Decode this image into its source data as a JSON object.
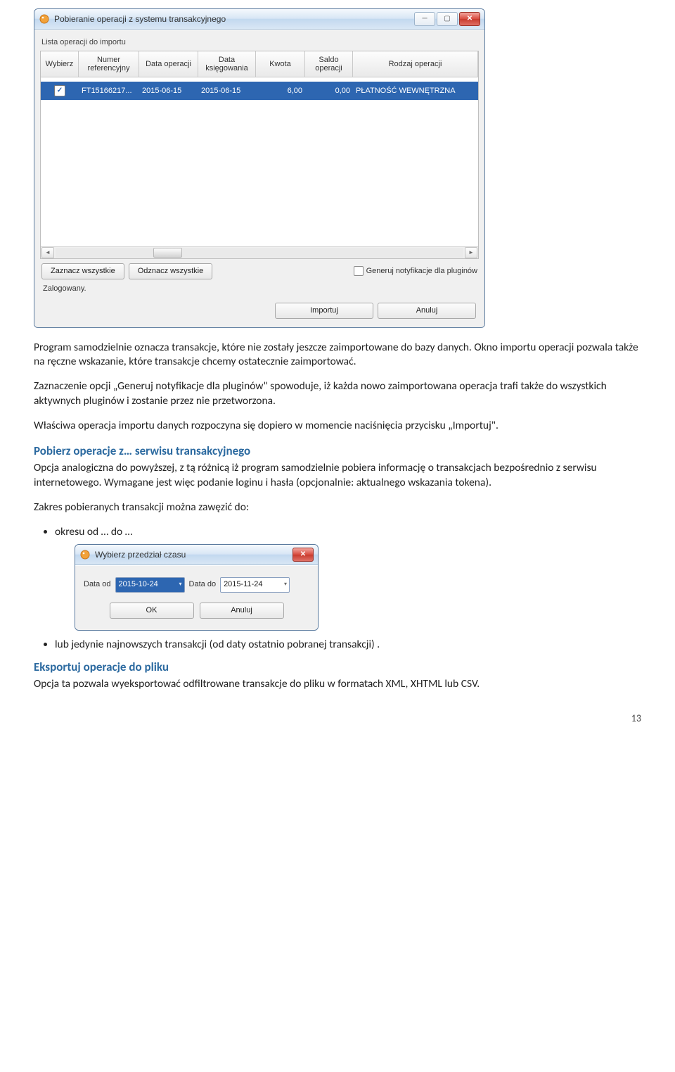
{
  "page_number": "13",
  "main_window": {
    "title": "Pobieranie operacji z systemu transakcyjnego",
    "list_label": "Lista operacji do importu",
    "columns": {
      "c1": "Wybierz",
      "c2": "Numer referencyjny",
      "c3": "Data operacji",
      "c4": "Data księgowania",
      "c5": "Kwota",
      "c6": "Saldo operacji",
      "c7": "Rodzaj operacji"
    },
    "row": {
      "checked_glyph": "✓",
      "ref": "FT15166217...",
      "op_date": "2015-06-15",
      "book_date": "2015-06-15",
      "amount": "6,00",
      "balance": "0,00",
      "type": "PŁATNOŚĆ WEWNĘTRZNA"
    },
    "select_all_label": "Zaznacz wszystkie",
    "deselect_all_label": "Odznacz wszystkie",
    "plugin_checkbox_label": "Generuj notyfikacje dla pluginów",
    "status_text": "Zalogowany.",
    "import_label": "Importuj",
    "cancel_label": "Anuluj"
  },
  "date_dialog": {
    "title": "Wybierz przedział czasu",
    "from_label": "Data od",
    "from_value": "2015-10-24",
    "to_label": "Data do",
    "to_value": "2015-11-24",
    "ok_label": "OK",
    "cancel_label": "Anuluj"
  },
  "text": {
    "p1": "Program samodzielnie oznacza transakcje, które nie zostały jeszcze zaimportowane do bazy danych. Okno importu operacji pozwala także na ręczne wskazanie, które transakcje chcemy ostatecznie zaimportować.",
    "p2": "Zaznaczenie opcji „Generuj notyfikacje dla pluginów\" spowoduje, iż każda nowo zaimportowana operacja trafi także do wszystkich aktywnych pluginów i zostanie przez nie przetworzona.",
    "p3": "Właściwa operacja importu danych rozpoczyna się dopiero w momencie naciśnięcia przycisku „Importuj\".",
    "h1": "Pobierz operacje z… serwisu transakcyjnego",
    "p4": "Opcja analogiczna do powyższej, z tą różnicą iż program samodzielnie pobiera informację o transakcjach bezpośrednio z serwisu internetowego. Wymagane jest więc podanie loginu i hasła (opcjonalnie: aktualnego wskazania tokena).",
    "p5": "Zakres pobieranych transakcji można zawęzić do:",
    "li1": "okresu od … do …",
    "li2": "lub jedynie najnowszych transakcji (od daty ostatnio pobranej transakcji) .",
    "h2": "Eksportuj operacje do pliku",
    "p6": "Opcja ta pozwala wyeksportować odfiltrowane transakcje do pliku w formatach XML, XHTML lub CSV."
  }
}
